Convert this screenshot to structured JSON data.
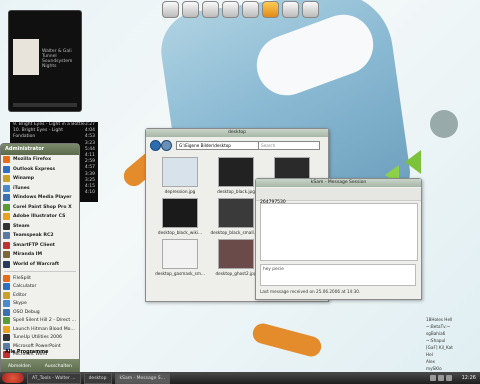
{
  "player": {
    "track_line1": "Walter & Gali",
    "track_line2": "Tunnel",
    "track_line3": "Soundsystem Nights"
  },
  "playlist": [
    {
      "title": "9. Bright Eyes - Light in a Bottle",
      "time": "3:27"
    },
    {
      "title": "10. Bright Eyes - Light Fondation",
      "time": "4:04"
    },
    {
      "title": "",
      "time": "4:53"
    },
    {
      "title": "",
      "time": "3:23"
    },
    {
      "title": "",
      "time": "5:44"
    },
    {
      "title": "",
      "time": "4:11"
    },
    {
      "title": "",
      "time": "2:59"
    },
    {
      "title": "",
      "time": "4:57"
    },
    {
      "title": "",
      "time": "3:39"
    },
    {
      "title": "",
      "time": "3:25"
    },
    {
      "title": "",
      "time": "4:15"
    },
    {
      "title": "",
      "time": "4:10"
    }
  ],
  "start_menu": {
    "header": "Administrator",
    "pinned": [
      "Mozilla Firefox",
      "Outlook Express",
      "Winamp",
      "iTunes",
      "Windows Media Player",
      "Corel Paint Shop Pro X",
      "Adobe Illustrator CS",
      "Steam",
      "Teamspeak RC2",
      "SmartFTP Client",
      "Miranda IM",
      "World of Warcraft"
    ],
    "recent": [
      "FileSplit",
      "Calculator",
      "Editor",
      "Skype",
      "OSO Debug",
      "Spell Silent Hill 2 - Direct ...",
      "Launch Hitman Blood Mo...",
      "TuneUp Utilities 2006",
      "Microsoft PowerPoint",
      "Microsoft Word"
    ],
    "all_programs": "Alle Programme",
    "logoff": "Abmelden",
    "shutdown": "Ausschalten"
  },
  "explorer": {
    "title": "desktop",
    "address": "G:\\Eigene Bilder\\desktop",
    "search_placeholder": "Search",
    "files": [
      {
        "name": "depression.jpg",
        "color": "#d8e2ea"
      },
      {
        "name": "desktop_black.jpg",
        "color": "#222222"
      },
      {
        "name": "desktop_black_e...jpg",
        "color": "#2a2a2a"
      },
      {
        "name": "desktop_black_wiki...",
        "color": "#1a1a1a"
      },
      {
        "name": "desktop_black_small.jpg",
        "color": "#3a3a3a"
      },
      {
        "name": "desktop_black_d...",
        "color": "#444444"
      },
      {
        "name": "desktop_gasmask_sm...",
        "color": "#f2f2f2"
      },
      {
        "name": "desktop_ghost2.jpg",
        "color": "#6b4a4a"
      },
      {
        "name": "desktop_ghost3_attr...",
        "color": "#8a8a8a"
      }
    ]
  },
  "messenger": {
    "title": "kSam - Message Session",
    "contact": "264797530",
    "input_text": "hey pecie",
    "status": "Last message received on 25.06.2006 at 14:30."
  },
  "desktop_list": [
    "18Holes Hell",
    "~:BetaTv:~",
    "sgBahia6",
    "~:Shapul",
    "[GaF] Kil_Kat",
    "Hel",
    "Alex",
    "mySKlo",
    "C4p0n3 [Markus]"
  ],
  "taskbar": {
    "tasks": [
      "AT_Tools - Walter ...",
      "desktop",
      "kSam - Message S..."
    ],
    "clock": "12:26"
  }
}
